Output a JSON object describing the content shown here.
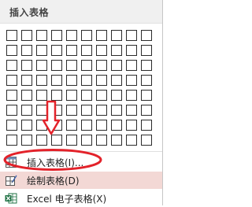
{
  "menu": {
    "title": "插入表格",
    "grid": {
      "rows": 8,
      "cols": 10
    },
    "items": [
      {
        "label": "插入表格(I)...",
        "icon": "table-icon"
      },
      {
        "label": "绘制表格(D)",
        "icon": "draw-table-icon"
      },
      {
        "label": "Excel 电子表格(X)",
        "icon": "excel-icon"
      }
    ]
  },
  "colors": {
    "annotation_red": "#e3222a",
    "hover_bg": "#f3d8d5"
  }
}
